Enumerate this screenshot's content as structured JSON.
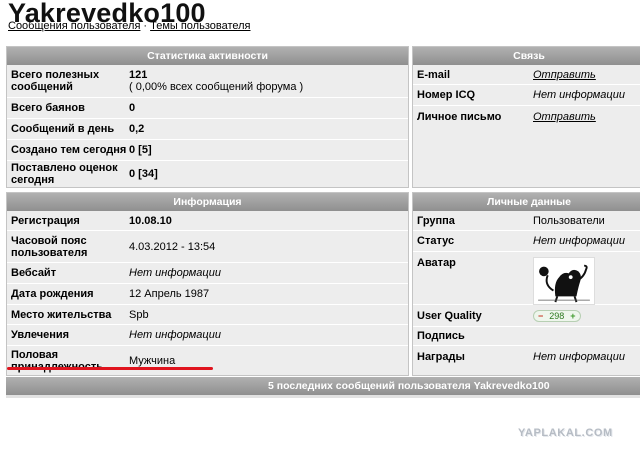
{
  "user": {
    "name": "Yakrevedko100",
    "links": [
      "Сообщения пользователя",
      "Темы пользователя"
    ],
    "separator": "·"
  },
  "stats": {
    "title": "Статистика активности",
    "rows": [
      {
        "label": "Всего полезных сообщений",
        "value": "121",
        "sub": "( 0,00% всех сообщений форума )"
      },
      {
        "label": "Всего баянов",
        "value": "0"
      },
      {
        "label": "Сообщений в день",
        "value": "0,2"
      },
      {
        "label": "Создано тем сегодня",
        "value": "0 [5]"
      },
      {
        "label": "Поставлено оценок сегодня",
        "value": "0 [34]"
      }
    ]
  },
  "contact": {
    "title": "Связь",
    "rows": [
      {
        "label": "E-mail",
        "value": "Отправить"
      },
      {
        "label": "Номер ICQ",
        "value": "Нет информации"
      },
      {
        "label": "Личное письмо",
        "value": "Отправить"
      }
    ]
  },
  "info": {
    "title": "Информация",
    "rows": [
      {
        "label": "Регистрация",
        "value": "10.08.10"
      },
      {
        "label": "Часовой пояс пользователя",
        "value": "4.03.2012 - 13:54"
      },
      {
        "label": "Вебсайт",
        "value": "Нет информации"
      },
      {
        "label": "Дата рождения",
        "value": "12 Апрель 1987"
      },
      {
        "label": "Место жительства",
        "value": "Spb"
      },
      {
        "label": "Увлечения",
        "value": "Нет информации"
      },
      {
        "label": "Половая принадлежность",
        "value": "Мужчина"
      }
    ]
  },
  "personal": {
    "title": "Личные данные",
    "rows": [
      {
        "label": "Группа",
        "value": "Пользователи"
      },
      {
        "label": "Статус",
        "value": "Нет информации"
      },
      {
        "label": "Аватар",
        "value": ""
      },
      {
        "label": "User Quality",
        "value": "298",
        "minus": "−",
        "plus": "+"
      },
      {
        "label": "Подпись",
        "value": ""
      },
      {
        "label": "Награды",
        "value": "Нет информации"
      }
    ]
  },
  "recent": {
    "title": "5 последних сообщений пользователя Yakrevedko100"
  },
  "watermark": "YAPLAKAL.COM",
  "colors": {
    "header": "#9f9f9f",
    "panel": "#ededed",
    "highlight": "#e0141e"
  }
}
